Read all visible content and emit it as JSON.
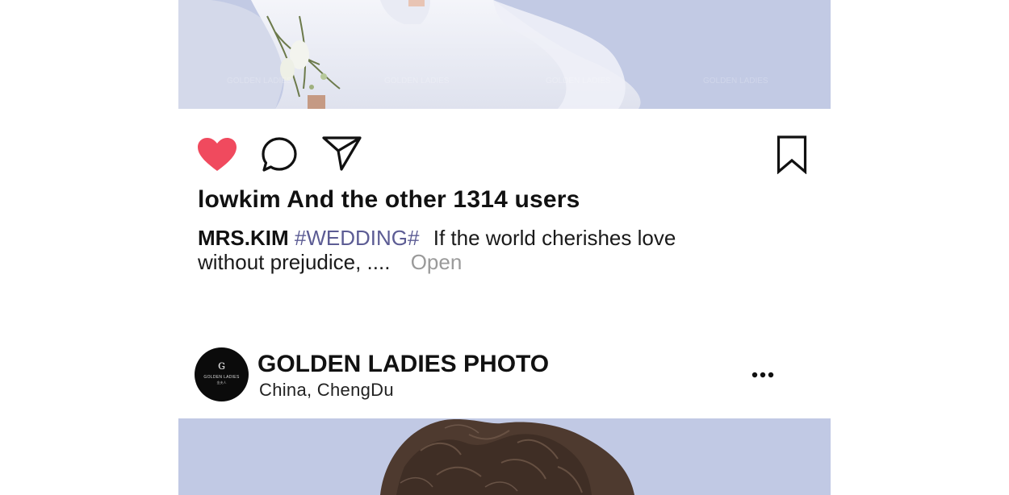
{
  "post_top": {
    "image_icon": "wedding-photo-image",
    "watermark": "GOLDEN LADIES",
    "actions": {
      "like_icon": "heart-filled-icon",
      "comment_icon": "speech-bubble-icon",
      "share_icon": "paper-plane-icon",
      "save_icon": "bookmark-icon",
      "like_color": "#f04a5e"
    },
    "likes_text": "lowkim And the other 1314 users",
    "caption": {
      "author": "MRS.KIM",
      "hashtag": "#WEDDING#",
      "text": "If the world cherishes love without prejudice, ....",
      "open_label": "Open"
    }
  },
  "post_next": {
    "avatar": {
      "logo_glyph": "ɢ",
      "logo_text": "GOLDEN LADIES",
      "logo_subtext": "金夫人"
    },
    "account_name": "GOLDEN LADIES PHOTO",
    "location": "China, ChengDu",
    "more_icon": "more-dots-icon",
    "image_icon": "portrait-photo-image"
  }
}
